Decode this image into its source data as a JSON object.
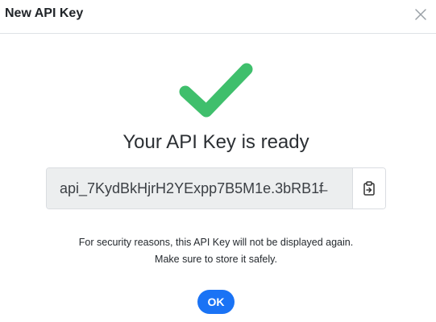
{
  "dialog": {
    "title": "New API Key",
    "close_icon": "close-icon"
  },
  "status": {
    "icon": "checkmark-icon",
    "icon_color": "#3fbf6c",
    "heading": "Your API Key is ready"
  },
  "api_key": {
    "value": "api_7KydBkHjrH2YExpp7B5M1e.3bRB1f̶",
    "copy_icon": "clipboard-copy-icon"
  },
  "note": {
    "line1": "For security reasons, this API Key will not be displayed again.",
    "line2": "Make sure to store it safely."
  },
  "actions": {
    "ok_label": "OK",
    "ok_color": "#1a73f5"
  }
}
